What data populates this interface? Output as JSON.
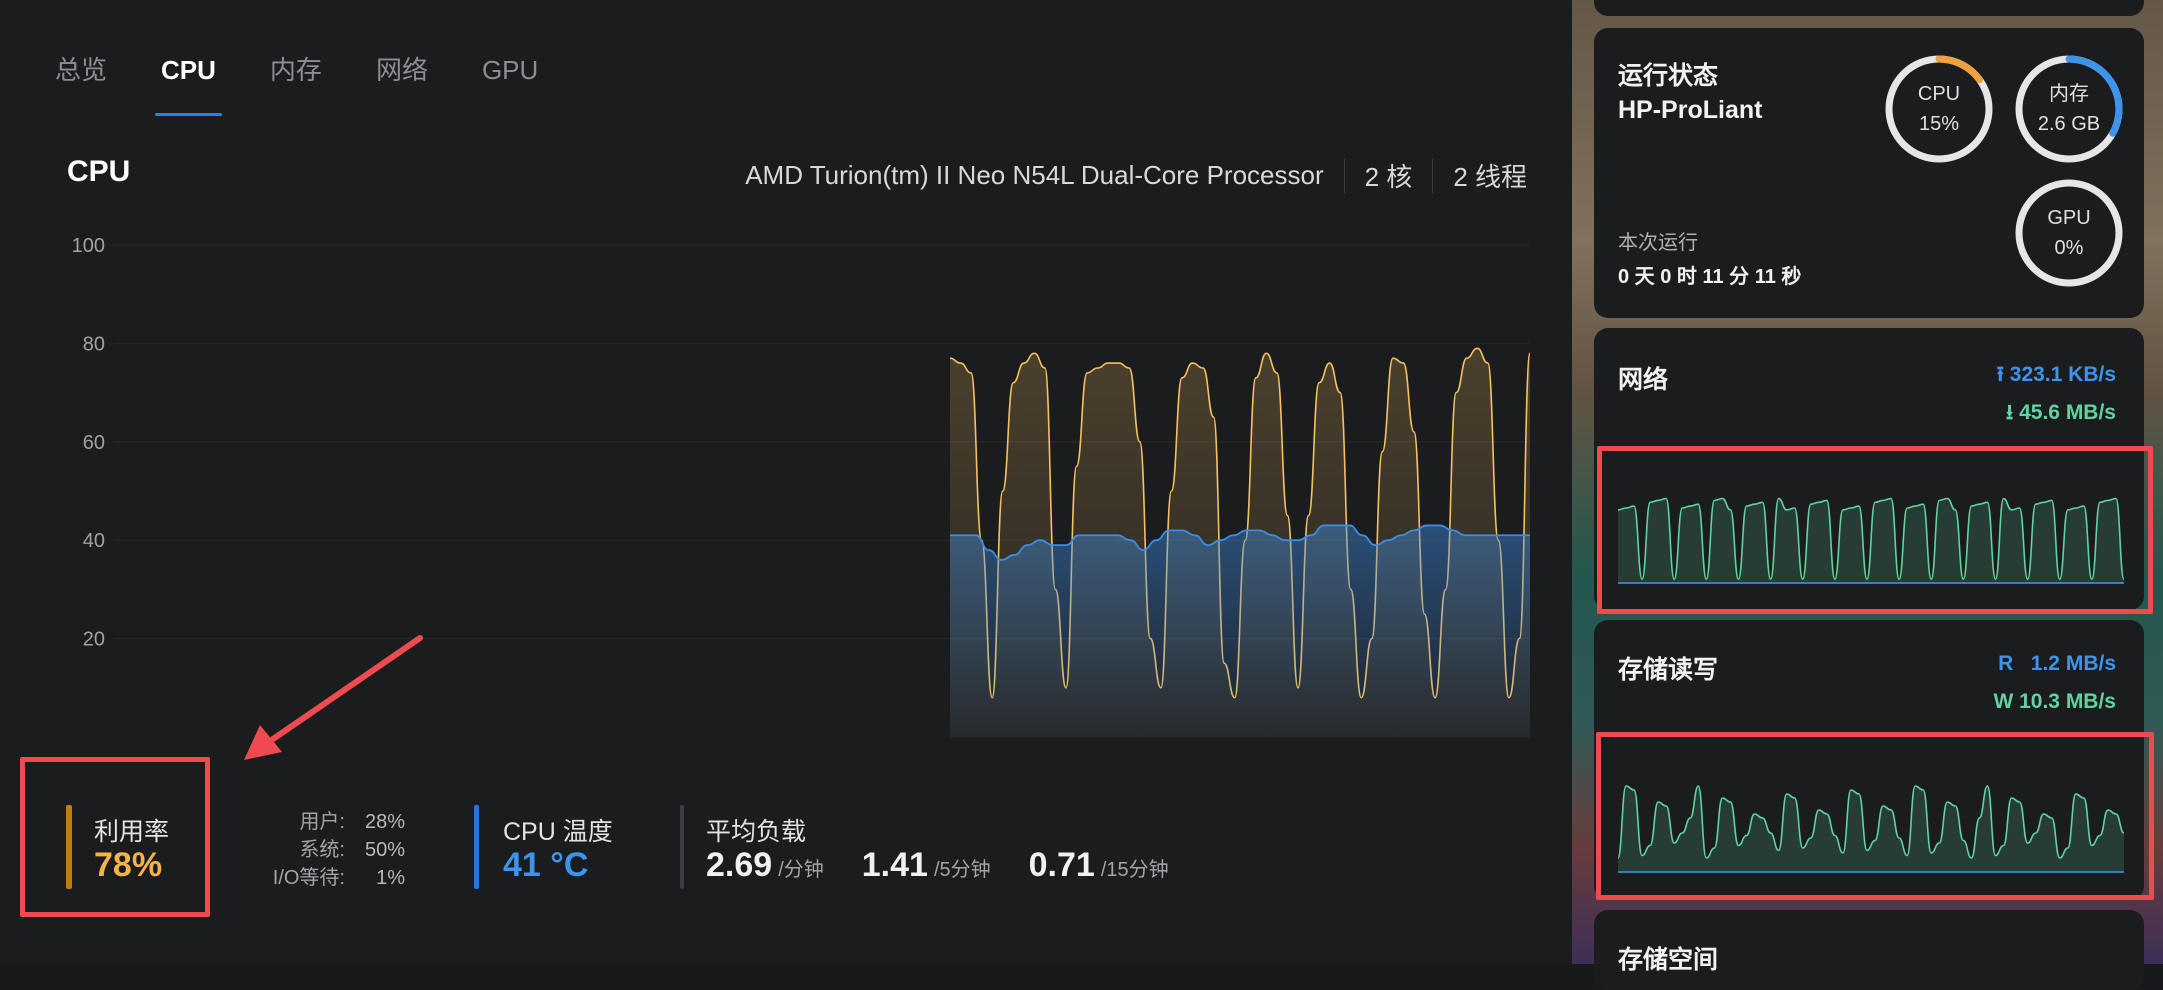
{
  "tabs": [
    "总览",
    "CPU",
    "内存",
    "网络",
    "GPU"
  ],
  "active_tab": "CPU",
  "cpu_panel": {
    "title": "CPU",
    "processor": "AMD Turion(tm) II Neo N54L Dual-Core Processor",
    "cores": "2 核",
    "threads": "2 线程"
  },
  "chart_data": {
    "type": "area",
    "ylim": [
      0,
      100
    ],
    "y_ticks": [
      "100",
      "80",
      "60",
      "40",
      "20"
    ],
    "grid": true,
    "series": [
      {
        "color": "#f5c060",
        "values": [
          77,
          76,
          74,
          40,
          8,
          50,
          72,
          76,
          78,
          75,
          30,
          10,
          55,
          74,
          75,
          76,
          76,
          75,
          60,
          20,
          10,
          50,
          73,
          76,
          75,
          65,
          15,
          8,
          40,
          73,
          78,
          74,
          45,
          10,
          45,
          72,
          76,
          70,
          30,
          8,
          20,
          58,
          77,
          76,
          62,
          25,
          8,
          30,
          70,
          77,
          79,
          76,
          40,
          8,
          20,
          78
        ]
      },
      {
        "color": "#3d8de6",
        "values": [
          41,
          41,
          41,
          38,
          36,
          37,
          39,
          40,
          39,
          39,
          41,
          41,
          41,
          41,
          40,
          38,
          40,
          42,
          42,
          41,
          39,
          40,
          41,
          42,
          42,
          41,
          40,
          40,
          41,
          43,
          43,
          43,
          41,
          39,
          40,
          41,
          42,
          43,
          43,
          42,
          41,
          41,
          41,
          41,
          41,
          41
        ]
      }
    ]
  },
  "stats": {
    "util_label": "利用率",
    "util_value": "78%",
    "user_label": "用户:",
    "user_value": "28%",
    "system_label": "系统:",
    "system_value": "50%",
    "io_label": "I/O等待:",
    "io_value": "1%",
    "temp_label": "CPU 温度",
    "temp_value": "41 °C",
    "load_label": "平均负载",
    "load_1": "2.69",
    "load_1_unit": "/分钟",
    "load_5": "1.41",
    "load_5_unit": "/5分钟",
    "load_15": "0.71",
    "load_15_unit": "/15分钟"
  },
  "status_card": {
    "title": "运行状态",
    "host": "HP-ProLiant",
    "uptime_label": "本次运行",
    "uptime_value": "0 天 0 时 11 分 11 秒",
    "cpu_ring": {
      "label": "CPU",
      "value": "15%",
      "fraction": 0.15,
      "color": "#f0a040"
    },
    "mem_ring": {
      "label": "内存",
      "value": "2.6 GB",
      "fraction": 0.33,
      "color": "#3d94ec"
    },
    "gpu_ring": {
      "label": "GPU",
      "value": "0%",
      "fraction": 0.0,
      "color": "#3d94ec"
    }
  },
  "network_card": {
    "title": "网络",
    "upload": "323.1 KB/s",
    "download": "45.6 MB/s",
    "upload_icon": "upload-arrow-icon",
    "download_icon": "download-arrow-icon"
  },
  "storage_card": {
    "title": "存储读写",
    "read_label": "R",
    "read_value": "1.2 MB/s",
    "write_label": "W",
    "write_value": "10.3 MB/s"
  },
  "storage_space_card": {
    "title": "存储空间"
  },
  "colors": {
    "accent_blue": "#2f7ee6",
    "cpu_orange": "#f6b349",
    "green": "#5fd3a0",
    "highlight_red": "#ee4a4f"
  }
}
